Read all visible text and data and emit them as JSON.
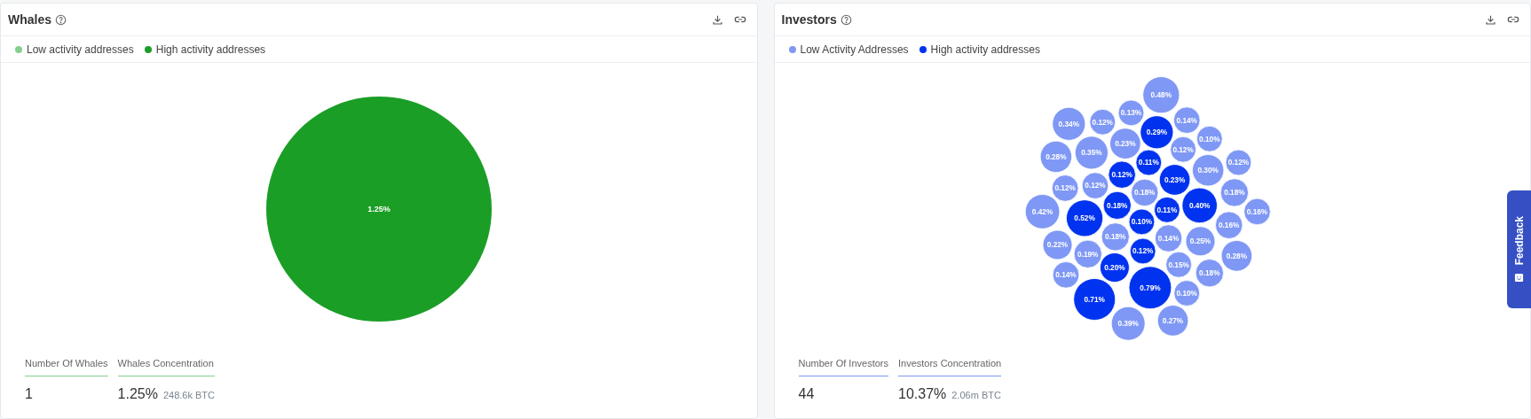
{
  "panels": [
    {
      "title": "Whales",
      "legend": [
        {
          "label": "Low activity addresses",
          "kind": "low",
          "color": "#86cf8f"
        },
        {
          "label": "High activity addresses",
          "kind": "high",
          "color": "#1a9e26"
        }
      ],
      "chart": {
        "kind": "pie",
        "slices": [
          {
            "label": "1.25%",
            "kind": "high"
          }
        ]
      },
      "stats": [
        {
          "label": "Number Of Whales",
          "value": "1"
        },
        {
          "label": "Whales Concentration",
          "value": "1.25%",
          "sub": "248.6k BTC"
        }
      ]
    },
    {
      "title": "Investors",
      "legend": [
        {
          "label": "Low Activity Addresses",
          "kind": "low",
          "color": "#7f98f5"
        },
        {
          "label": "High activity addresses",
          "kind": "high",
          "color": "#0033f0"
        }
      ],
      "chart": {
        "kind": "bubbles",
        "bubbles": [
          {
            "label": "0.48%",
            "kind": "low"
          },
          {
            "label": "0.34%",
            "kind": "low"
          },
          {
            "label": "0.12%",
            "kind": "low"
          },
          {
            "label": "0.13%",
            "kind": "low"
          },
          {
            "label": "0.29%",
            "kind": "high"
          },
          {
            "label": "0.14%",
            "kind": "low"
          },
          {
            "label": "0.10%",
            "kind": "low"
          },
          {
            "label": "0.28%",
            "kind": "low"
          },
          {
            "label": "0.35%",
            "kind": "low"
          },
          {
            "label": "0.23%",
            "kind": "low"
          },
          {
            "label": "0.11%",
            "kind": "high"
          },
          {
            "label": "0.12%",
            "kind": "low"
          },
          {
            "label": "0.12%",
            "kind": "high"
          },
          {
            "label": "0.23%",
            "kind": "high"
          },
          {
            "label": "0.30%",
            "kind": "low"
          },
          {
            "label": "0.12%",
            "kind": "low"
          },
          {
            "label": "0.12%",
            "kind": "low"
          },
          {
            "label": "0.12%",
            "kind": "low"
          },
          {
            "label": "0.18%",
            "kind": "low"
          },
          {
            "label": "0.18%",
            "kind": "low"
          },
          {
            "label": "0.42%",
            "kind": "low"
          },
          {
            "label": "0.52%",
            "kind": "high"
          },
          {
            "label": "0.18%",
            "kind": "high"
          },
          {
            "label": "0.11%",
            "kind": "high"
          },
          {
            "label": "0.40%",
            "kind": "high"
          },
          {
            "label": "0.16%",
            "kind": "low"
          },
          {
            "label": "0.10%",
            "kind": "high"
          },
          {
            "label": "0.16%",
            "kind": "low"
          },
          {
            "label": "0.18%",
            "kind": "low"
          },
          {
            "label": "0.14%",
            "kind": "low"
          },
          {
            "label": "0.25%",
            "kind": "low"
          },
          {
            "label": "0.22%",
            "kind": "low"
          },
          {
            "label": "0.19%",
            "kind": "low"
          },
          {
            "label": "0.12%",
            "kind": "high"
          },
          {
            "label": "0.28%",
            "kind": "low"
          },
          {
            "label": "0.20%",
            "kind": "high"
          },
          {
            "label": "0.15%",
            "kind": "low"
          },
          {
            "label": "0.14%",
            "kind": "low"
          },
          {
            "label": "0.18%",
            "kind": "low"
          },
          {
            "label": "0.79%",
            "kind": "high"
          },
          {
            "label": "0.71%",
            "kind": "high"
          },
          {
            "label": "0.10%",
            "kind": "low"
          },
          {
            "label": "0.39%",
            "kind": "low"
          },
          {
            "label": "0.27%",
            "kind": "low"
          }
        ]
      },
      "stats": [
        {
          "label": "Number Of Investors",
          "value": "44"
        },
        {
          "label": "Investors Concentration",
          "value": "10.37%",
          "sub": "2.06m BTC"
        }
      ]
    }
  ],
  "feedback": {
    "label": "Feedback"
  }
}
